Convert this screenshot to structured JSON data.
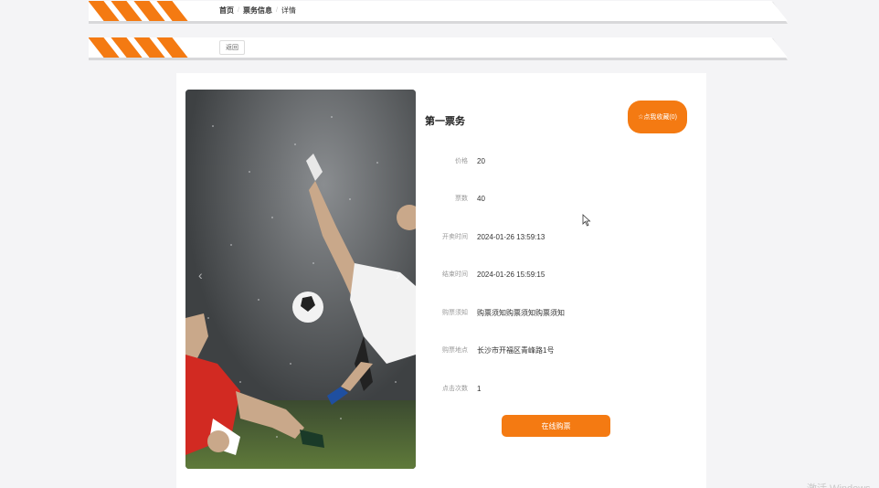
{
  "breadcrumb": {
    "home": "首页",
    "section": "票务信息",
    "current": "详情"
  },
  "toolbar": {
    "back_label": "返回"
  },
  "detail": {
    "title": "第一票务",
    "favorite_label": "☆点我收藏(0)",
    "fields": [
      {
        "label": "价格",
        "value": "20"
      },
      {
        "label": "票数",
        "value": "40"
      },
      {
        "label": "开卖时间",
        "value": "2024-01-26 13:59:13"
      },
      {
        "label": "结束时间",
        "value": "2024-01-26 15:59:15"
      },
      {
        "label": "购票须知",
        "value": "购票须知购票须知购票须知"
      },
      {
        "label": "购票地点",
        "value": "长沙市开福区青峰路1号"
      },
      {
        "label": "点击次数",
        "value": "1"
      }
    ],
    "buy_label": "在线购票"
  },
  "carousel": {
    "prev_icon": "‹",
    "next_icon": "›"
  },
  "watermark": "激活 Windows",
  "colors": {
    "accent": "#f47a12",
    "background": "#f4f4f6",
    "card": "#ffffff"
  }
}
